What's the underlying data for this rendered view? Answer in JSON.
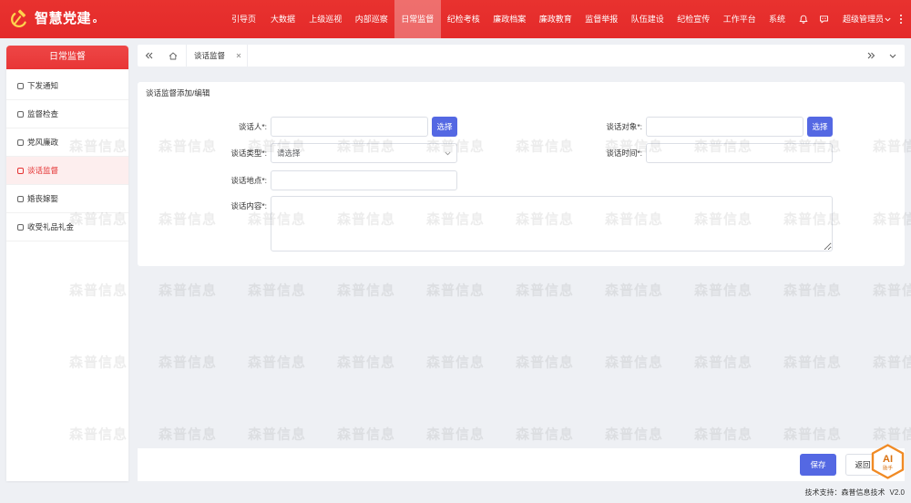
{
  "colors": {
    "header_red": "#e42a2a",
    "sidebar_header_red": "#e83636",
    "primary_button": "#5468e3",
    "active_text": "#e53333",
    "active_bg": "#fdeeee",
    "assistant_badge": "#f08a24"
  },
  "header": {
    "app_title": "智慧党建",
    "logo_icon": "party-emblem-icon",
    "nav": [
      {
        "label": "引导页"
      },
      {
        "label": "大数据"
      },
      {
        "label": "上级巡视"
      },
      {
        "label": "内部巡察"
      },
      {
        "label": "日常监督",
        "active": true
      },
      {
        "label": "纪检考核"
      },
      {
        "label": "廉政档案"
      },
      {
        "label": "廉政教育"
      },
      {
        "label": "监督举报"
      },
      {
        "label": "队伍建设"
      },
      {
        "label": "纪检宣传"
      },
      {
        "label": "工作平台"
      },
      {
        "label": "系统"
      }
    ],
    "tools": {
      "notifications_icon": "bell-icon",
      "messages_icon": "chat-icon",
      "more_icon": "more-vertical-icon"
    },
    "user": {
      "name": "超级管理员",
      "menu_icon": "chevron-down-icon"
    }
  },
  "sidebar": {
    "title": "日常监督",
    "item_icon": "square-outline-icon",
    "items": [
      {
        "label": "下发通知"
      },
      {
        "label": "监督检查"
      },
      {
        "label": "党风廉政"
      },
      {
        "label": "谈话监督",
        "active": true
      },
      {
        "label": "婚丧嫁娶"
      },
      {
        "label": "收受礼品礼金"
      }
    ]
  },
  "tabs": {
    "scroll_left_icon": "double-chevron-left-icon",
    "home_icon": "home-icon",
    "items": [
      {
        "label": "谈话监督",
        "active": true,
        "close_icon": "close-icon"
      }
    ],
    "scroll_right_icon": "double-chevron-right-icon",
    "menu_icon": "chevron-down-icon"
  },
  "form": {
    "title": "谈话监督添加/编辑",
    "fields": {
      "talker": {
        "label": "谈话人*:",
        "value": "",
        "button": "选择"
      },
      "talk_target": {
        "label": "谈话对象*:",
        "value": "",
        "button": "选择"
      },
      "talk_type": {
        "label": "谈话类型*:",
        "placeholder": "请选择"
      },
      "talk_time": {
        "label": "谈话时间*:",
        "value": ""
      },
      "talk_place": {
        "label": "谈话地点*:",
        "value": ""
      },
      "talk_content": {
        "label": "谈话内容*:",
        "value": ""
      }
    }
  },
  "actions": {
    "save": "保存",
    "back": "返回"
  },
  "assistant_badge": {
    "title": "AI",
    "subtitle": "助手"
  },
  "watermark": {
    "text": "森普信息"
  },
  "footer": {
    "support": "技术支持：森普信息技术",
    "version": "V2.0"
  }
}
